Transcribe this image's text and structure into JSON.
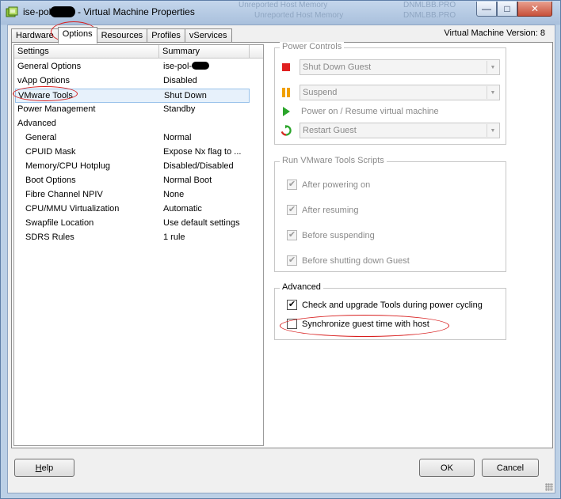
{
  "window": {
    "title_prefix": "ise-pol-",
    "title_suffix": " - Virtual Machine Properties",
    "background_ghost_1": "Unreported Host Memory",
    "background_ghost_2": "Unreported Host Memory",
    "background_ghost_3": "DNMLBB.PRO",
    "background_ghost_4": "DNMLBB.PRO",
    "minimize_glyph": "—",
    "maximize_glyph": "□",
    "close_glyph": "✕"
  },
  "tabs": [
    {
      "label": "Hardware",
      "active": false
    },
    {
      "label": "Options",
      "active": true
    },
    {
      "label": "Resources",
      "active": false
    },
    {
      "label": "Profiles",
      "active": false
    },
    {
      "label": "vServices",
      "active": false
    }
  ],
  "vm_version": "Virtual Machine Version: 8",
  "settings": {
    "headers": [
      "Settings",
      "Summary"
    ],
    "rows": [
      {
        "setting": "General Options",
        "summary": "ise-pol-",
        "indent": false,
        "redacted": true
      },
      {
        "setting": "vApp Options",
        "summary": "Disabled",
        "indent": false
      },
      {
        "setting": "VMware Tools",
        "summary": "Shut Down",
        "indent": false,
        "selected": true
      },
      {
        "setting": "Power Management",
        "summary": "Standby",
        "indent": false
      },
      {
        "setting": "Advanced",
        "summary": "",
        "indent": false
      },
      {
        "setting": "General",
        "summary": "Normal",
        "indent": true
      },
      {
        "setting": "CPUID Mask",
        "summary": "Expose Nx flag to ...",
        "indent": true
      },
      {
        "setting": "Memory/CPU Hotplug",
        "summary": "Disabled/Disabled",
        "indent": true
      },
      {
        "setting": "Boot Options",
        "summary": "Normal Boot",
        "indent": true
      },
      {
        "setting": "Fibre Channel NPIV",
        "summary": "None",
        "indent": true
      },
      {
        "setting": "CPU/MMU Virtualization",
        "summary": "Automatic",
        "indent": true
      },
      {
        "setting": "Swapfile Location",
        "summary": "Use default settings",
        "indent": true
      },
      {
        "setting": "SDRS Rules",
        "summary": "1 rule",
        "indent": true
      }
    ]
  },
  "power_controls": {
    "label": "Power Controls",
    "stop_select": "Shut Down Guest",
    "suspend_select": "Suspend",
    "power_on_label": "Power on / Resume virtual machine",
    "restart_select": "Restart Guest",
    "colors": {
      "stop": "#e02020",
      "suspend": "#f0a000",
      "play": "#2aa52a"
    }
  },
  "scripts": {
    "label": "Run VMware Tools Scripts",
    "items": [
      {
        "label": "After powering on",
        "checked": true
      },
      {
        "label": "After resuming",
        "checked": true
      },
      {
        "label": "Before suspending",
        "checked": true
      },
      {
        "label": "Before shutting down Guest",
        "checked": true
      }
    ]
  },
  "advanced": {
    "label": "Advanced",
    "check_upgrade": {
      "label": "Check and upgrade Tools during power cycling",
      "checked": true
    },
    "sync_time": {
      "label": "Synchronize guest time with host",
      "checked": false
    }
  },
  "buttons": {
    "help_mnemonic": "H",
    "help_rest": "elp",
    "ok": "OK",
    "cancel": "Cancel"
  },
  "check_glyph": "✔",
  "annotation_color": "#d81e1e"
}
